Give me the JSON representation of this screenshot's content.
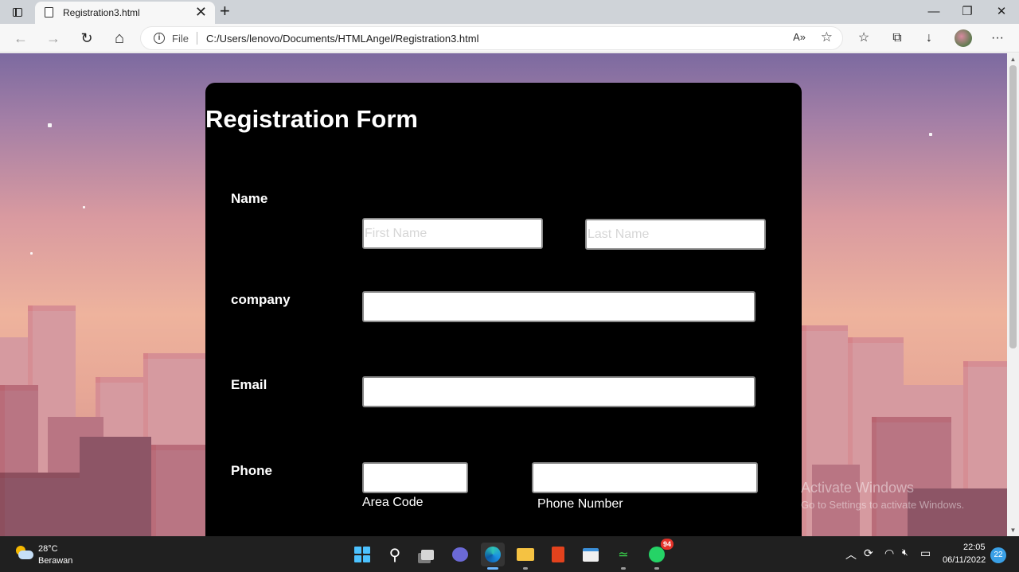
{
  "browser": {
    "tab_title": "Registration3.html",
    "tab_close": "✕",
    "new_tab": "+",
    "scheme": "File",
    "url": "C:/Users/lenovo/Documents/HTMLAngel/Registration3.html",
    "read_aloud": "A»",
    "window": {
      "minimize": "—",
      "restore": "❐",
      "close": "✕"
    },
    "nav": {
      "back": "←",
      "forward": "→",
      "refresh": "↻",
      "home": "⌂"
    },
    "tools": {
      "favorites": "☆",
      "collections": "⧉",
      "downloads": "↓",
      "more": "···",
      "favorite_add": "☆"
    }
  },
  "form": {
    "title": "Registration Form",
    "name_label": "Name",
    "first_name_placeholder": "First Name",
    "last_name_placeholder": "Last Name",
    "company_label": "company",
    "email_label": "Email",
    "phone_label": "Phone",
    "area_code_label": "Area Code",
    "phone_number_label": "Phone Number"
  },
  "watermark": {
    "title": "Activate Windows",
    "subtitle": "Go to Settings to activate Windows."
  },
  "taskbar": {
    "temperature": "28°C",
    "condition": "Berawan",
    "whatsapp_badge": "94",
    "time": "22:05",
    "date": "06/11/2022",
    "notifications": "22",
    "tray": {
      "chevron": "︿",
      "sync": "⟳",
      "wifi": "◠",
      "volume": "🔇︎",
      "battery": "▭"
    }
  }
}
